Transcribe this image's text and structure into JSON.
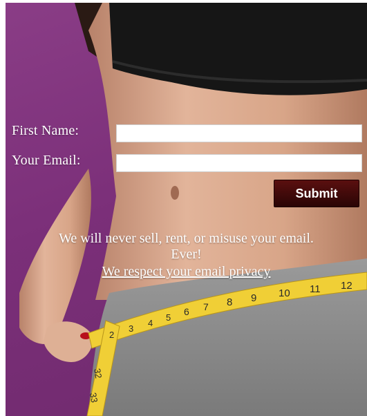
{
  "form": {
    "first_name_label": "First Name:",
    "email_label": "Your Email:",
    "first_name_value": "",
    "email_value": "",
    "submit_label": "Submit"
  },
  "privacy": {
    "line1": "We will never sell, rent, or misuse your email.",
    "line2": "Ever!",
    "link": "We respect your email privacy"
  },
  "tape_numbers": [
    "2",
    "3",
    "4",
    "5",
    "6",
    "7",
    "8",
    "9",
    "10",
    "11",
    "12",
    "32",
    "33"
  ],
  "colors": {
    "background": "#7b2f79",
    "submit_button": "#3a0808",
    "tape": "#f2d23a",
    "shorts": "#8d8d8d",
    "top": "#1a1a1a",
    "skin": "#d9a88a"
  }
}
